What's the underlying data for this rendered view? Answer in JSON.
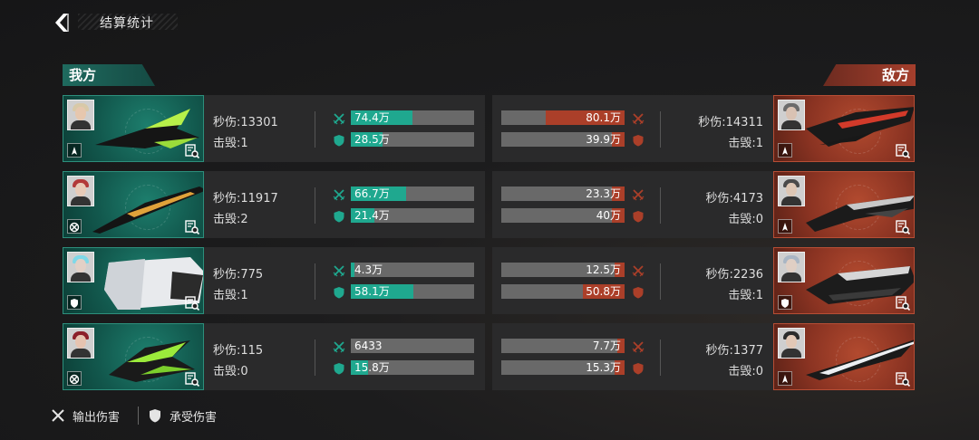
{
  "header": {
    "title": "结算统计",
    "back_icon": "back-arrow-icon"
  },
  "ally_label": "我方",
  "enemy_label": "敌方",
  "colors": {
    "ally": "#1fa88f",
    "enemy": "#ab3f29",
    "bar_bg": "#696969"
  },
  "ally": [
    {
      "dps_label": "秒伤:",
      "dps": "13301",
      "kills_label": "击毁:",
      "kills": "1",
      "damage_dealt": "74.4万",
      "damage_dealt_pct": 0.5,
      "damage_taken": "28.5万",
      "damage_taken_pct": 0.26,
      "class_icon": "fighter-class-icon"
    },
    {
      "dps_label": "秒伤:",
      "dps": "11917",
      "kills_label": "击毁:",
      "kills": "2",
      "damage_dealt": "66.7万",
      "damage_dealt_pct": 0.45,
      "damage_taken": "21.4万",
      "damage_taken_pct": 0.19,
      "class_icon": "support-class-icon"
    },
    {
      "dps_label": "秒伤:",
      "dps": "775",
      "kills_label": "击毁:",
      "kills": "1",
      "damage_dealt": "4.3万",
      "damage_dealt_pct": 0.03,
      "damage_taken": "58.1万",
      "damage_taken_pct": 0.51,
      "class_icon": "shield-class-icon"
    },
    {
      "dps_label": "秒伤:",
      "dps": "115",
      "kills_label": "击毁:",
      "kills": "0",
      "damage_dealt": "6433",
      "damage_dealt_pct": 0.0,
      "damage_taken": "15.8万",
      "damage_taken_pct": 0.14,
      "class_icon": "support-class-icon"
    }
  ],
  "enemy": [
    {
      "dps_label": "秒伤:",
      "dps": "14311",
      "kills_label": "击毁:",
      "kills": "1",
      "damage_dealt": "80.1万",
      "damage_dealt_pct": 0.64,
      "damage_taken": "39.9万",
      "damage_taken_pct": 0.1,
      "class_icon": "fighter-class-icon"
    },
    {
      "dps_label": "秒伤:",
      "dps": "4173",
      "kills_label": "击毁:",
      "kills": "0",
      "damage_dealt": "23.3万",
      "damage_dealt_pct": 0.1,
      "damage_taken": "40万",
      "damage_taken_pct": 0.1,
      "class_icon": "fighter-class-icon"
    },
    {
      "dps_label": "秒伤:",
      "dps": "2236",
      "kills_label": "击毁:",
      "kills": "1",
      "damage_dealt": "12.5万",
      "damage_dealt_pct": 0.08,
      "damage_taken": "50.8万",
      "damage_taken_pct": 0.34,
      "class_icon": "shield-class-icon"
    },
    {
      "dps_label": "秒伤:",
      "dps": "1377",
      "kills_label": "击毁:",
      "kills": "0",
      "damage_dealt": "7.7万",
      "damage_dealt_pct": 0.06,
      "damage_taken": "15.3万",
      "damage_taken_pct": 0.08,
      "class_icon": "fighter-class-icon"
    }
  ],
  "legend": {
    "dealt": "输出伤害",
    "taken": "承受伤害",
    "dealt_icon": "crossed-swords-icon",
    "taken_icon": "shield-icon"
  }
}
